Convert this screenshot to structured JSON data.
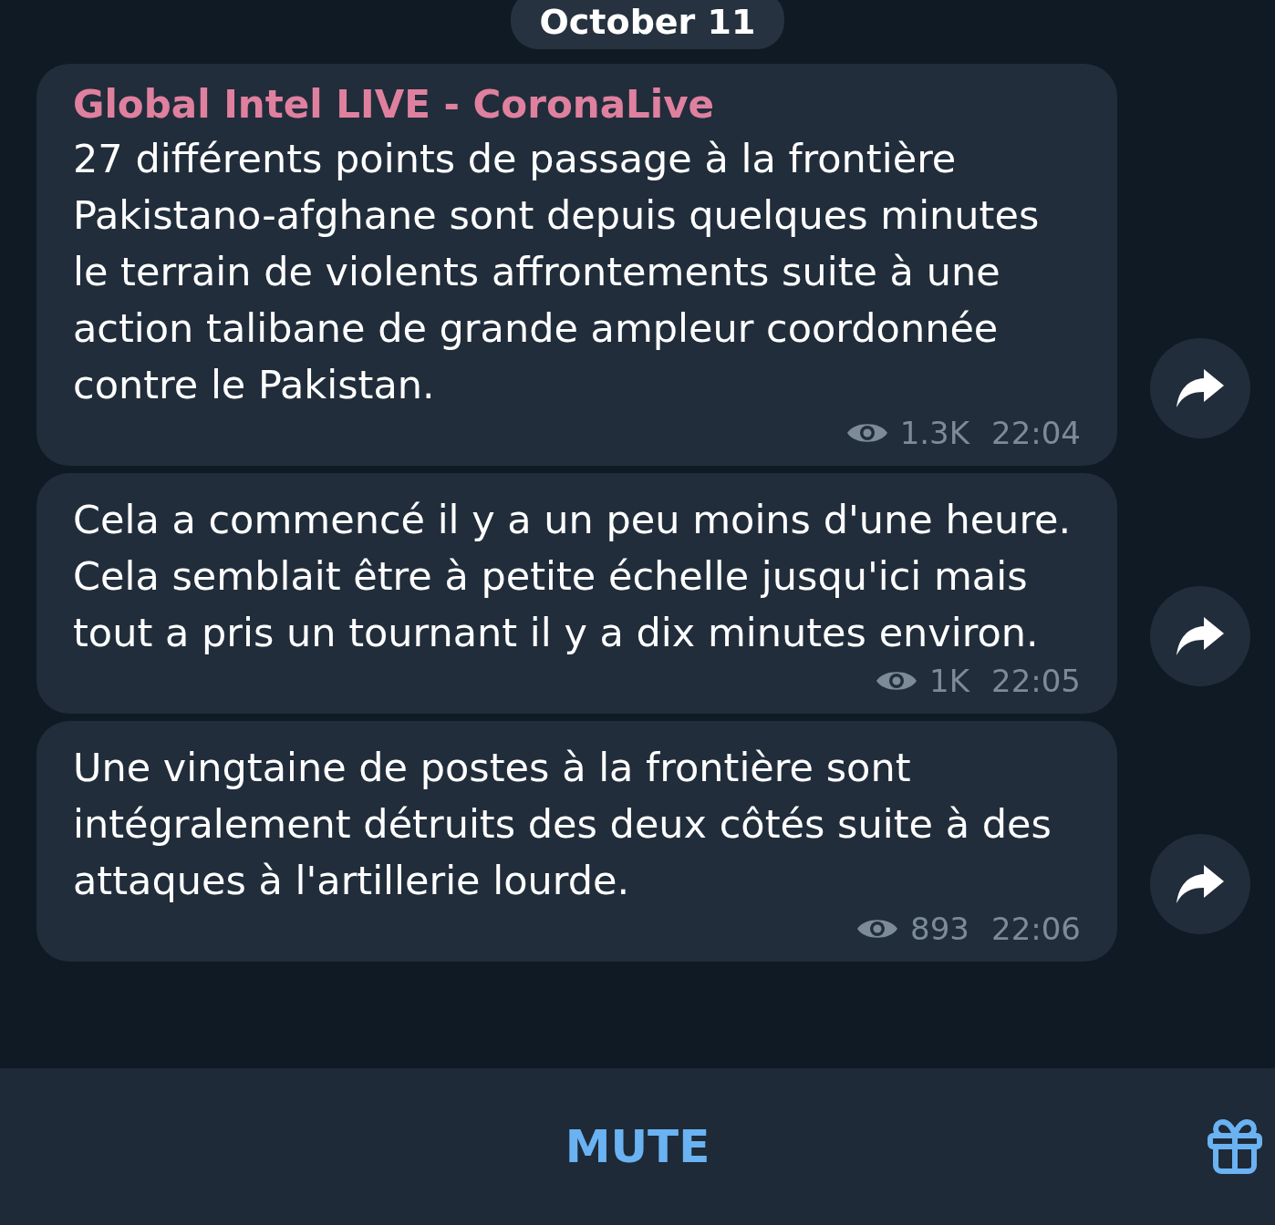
{
  "date_pill": "October 11",
  "messages": [
    {
      "sender": "Global Intel LIVE - CoronaLive",
      "text": "27 différents points de passage à la frontière Pakistano-afghane sont depuis quelques minutes le terrain de violents affrontements suite à une action talibane de grande ampleur coordonnée contre le Pakistan.",
      "views": "1.3K",
      "time": "22:04"
    },
    {
      "text": "Cela a commencé il y a un peu moins d'une heure. Cela semblait être à petite échelle jusqu'ici mais tout a pris un tournant il y a dix minutes environ.",
      "views": "1K",
      "time": "22:05"
    },
    {
      "text": "Une vingtaine de postes à la frontière sont intégralement détruits des deux côtés suite à des attaques à l'artillerie lourde.",
      "views": "893",
      "time": "22:06"
    }
  ],
  "bottom_bar": {
    "button": "MUTE"
  }
}
